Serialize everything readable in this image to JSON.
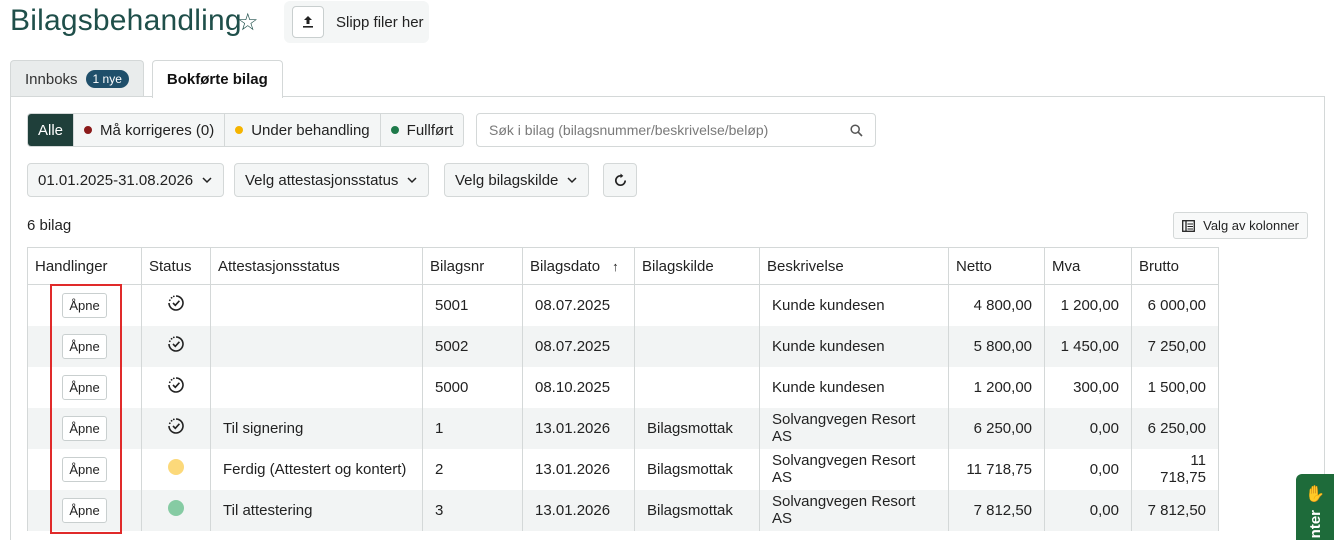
{
  "page": {
    "title": "Bilagsbehandling",
    "dropzone_label": "Slipp filer her"
  },
  "tabs": [
    {
      "label": "Innboks",
      "badge": "1 nye"
    },
    {
      "label": "Bokførte bilag"
    }
  ],
  "filters": {
    "all": "Alle",
    "correct": "Må korrigeres (0)",
    "pending": "Under behandling",
    "done": "Fullført",
    "colors": {
      "correct": "#8b1a1a",
      "pending": "#f5b400",
      "done": "#1e7a4a"
    }
  },
  "search": {
    "placeholder": "Søk i bilag (bilagsnummer/beskrivelse/beløp)"
  },
  "dropdowns": {
    "date_range": "01.01.2025-31.08.2026",
    "attest": "Velg attestasjonsstatus",
    "source": "Velg bilagskilde"
  },
  "count_label": "6 bilag",
  "columns_button": "Valg av kolonner",
  "table": {
    "headers": [
      "Handlinger",
      "Status",
      "Attestasjonsstatus",
      "Bilagsnr",
      "Bilagsdato",
      "Bilagskilde",
      "Beskrivelse",
      "Netto",
      "Mva",
      "Brutto"
    ],
    "action_label": "Åpne",
    "rows": [
      {
        "status": "pending-icon",
        "attest": "",
        "nr": "5001",
        "date": "08.07.2025",
        "source": "",
        "desc": "Kunde kundesen",
        "netto": "4 800,00",
        "mva": "1 200,00",
        "brutto": "6 000,00"
      },
      {
        "status": "pending-icon",
        "attest": "",
        "nr": "5002",
        "date": "08.07.2025",
        "source": "",
        "desc": "Kunde kundesen",
        "netto": "5 800,00",
        "mva": "1 450,00",
        "brutto": "7 250,00"
      },
      {
        "status": "pending-icon",
        "attest": "",
        "nr": "5000",
        "date": "08.10.2025",
        "source": "",
        "desc": "Kunde kundesen",
        "netto": "1 200,00",
        "mva": "300,00",
        "brutto": "1 500,00"
      },
      {
        "status": "pending-icon",
        "attest": "Til signering",
        "nr": "1",
        "date": "13.01.2026",
        "source": "Bilagsmottak",
        "desc": "Solvangvegen Resort AS",
        "netto": "6 250,00",
        "mva": "0,00",
        "brutto": "6 250,00"
      },
      {
        "status": "yellow-dot",
        "attest": "Ferdig (Attestert og kontert)",
        "nr": "2",
        "date": "13.01.2026",
        "source": "Bilagsmottak",
        "desc": "Solvangvegen Resort AS",
        "netto": "11 718,75",
        "mva": "0,00",
        "brutto": "11 718,75"
      },
      {
        "status": "green-dot",
        "attest": "Til attestering",
        "nr": "3",
        "date": "13.01.2026",
        "source": "Bilagsmottak",
        "desc": "Solvangvegen Resort AS",
        "netto": "7 812,50",
        "mva": "0,00",
        "brutto": "7 812,50"
      }
    ]
  },
  "side_tab": {
    "label": "nter"
  }
}
